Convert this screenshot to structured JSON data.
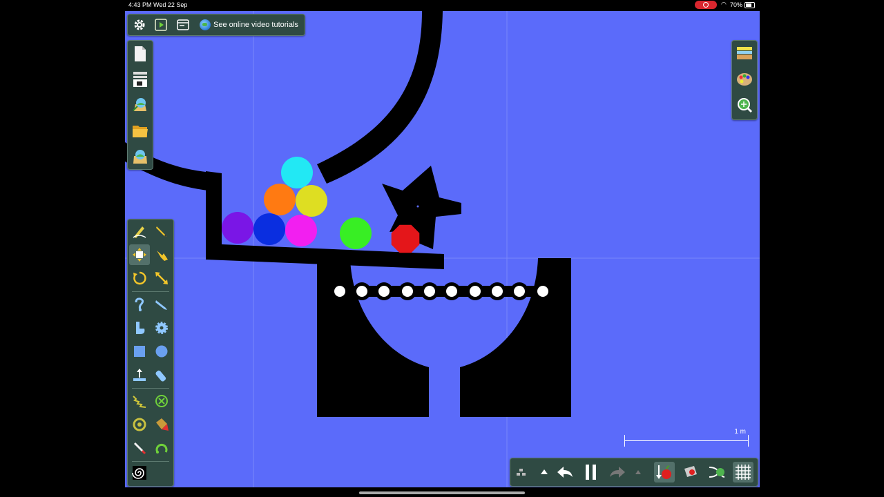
{
  "status_bar": {
    "time": "4:43 PM  Wed 22 Sep",
    "battery": "70%"
  },
  "top_bar": {
    "tutorial_label": "See online video tutorials",
    "icons": [
      "gear-icon",
      "play-icon",
      "window-icon",
      "globe-icon"
    ]
  },
  "file_toolbar": {
    "icons": [
      "new-file-icon",
      "list-icon",
      "import-scene-icon",
      "open-folder-icon",
      "save-scene-icon"
    ]
  },
  "right_toolbar": {
    "icons": [
      "layers-icon",
      "palette-icon",
      "zoom-icon"
    ]
  },
  "tool_palette": {
    "selected": "move-tool",
    "icons": [
      "sketch-tool-icon",
      "pencil-tool-icon",
      "move-tool-icon",
      "drag-tool-icon",
      "rotate-tool-icon",
      "scale-tool-icon",
      "rope-tool-icon",
      "knife-tool-icon",
      "brush-tool-icon",
      "gear-tool-icon",
      "box-tool-icon",
      "circle-tool-icon",
      "fixate-tool-icon",
      "laser-tool-icon",
      "spring-tool-icon",
      "axle-tool-icon",
      "thruster-tool-icon",
      "tracer-tool-icon",
      "pen-tool-icon",
      "hinge-tool-icon",
      "vortex-tool-icon"
    ]
  },
  "bottom_bar": {
    "icons": [
      "grid-dots-icon",
      "arrow-up-icon",
      "undo-icon",
      "pause-icon",
      "redo-icon",
      "arrow-up-small-icon",
      "gravity-icon",
      "air-friction-icon",
      "controller-icon",
      "grid-icon"
    ]
  },
  "scale_label": "1 m",
  "colors": {
    "background": "#5b6bfa",
    "panel": "#2f4a43",
    "shapes": "#000000"
  },
  "balls": [
    {
      "name": "ball-cyan",
      "color": "#22e8f4"
    },
    {
      "name": "ball-orange",
      "color": "#ff7a12"
    },
    {
      "name": "ball-yellow",
      "color": "#dede22"
    },
    {
      "name": "ball-purple",
      "color": "#7a16e6"
    },
    {
      "name": "ball-blue",
      "color": "#0a2ee0"
    },
    {
      "name": "ball-magenta",
      "color": "#f21ff0"
    },
    {
      "name": "ball-green",
      "color": "#38ee24"
    },
    {
      "name": "ball-red",
      "color": "#e4161a"
    }
  ]
}
